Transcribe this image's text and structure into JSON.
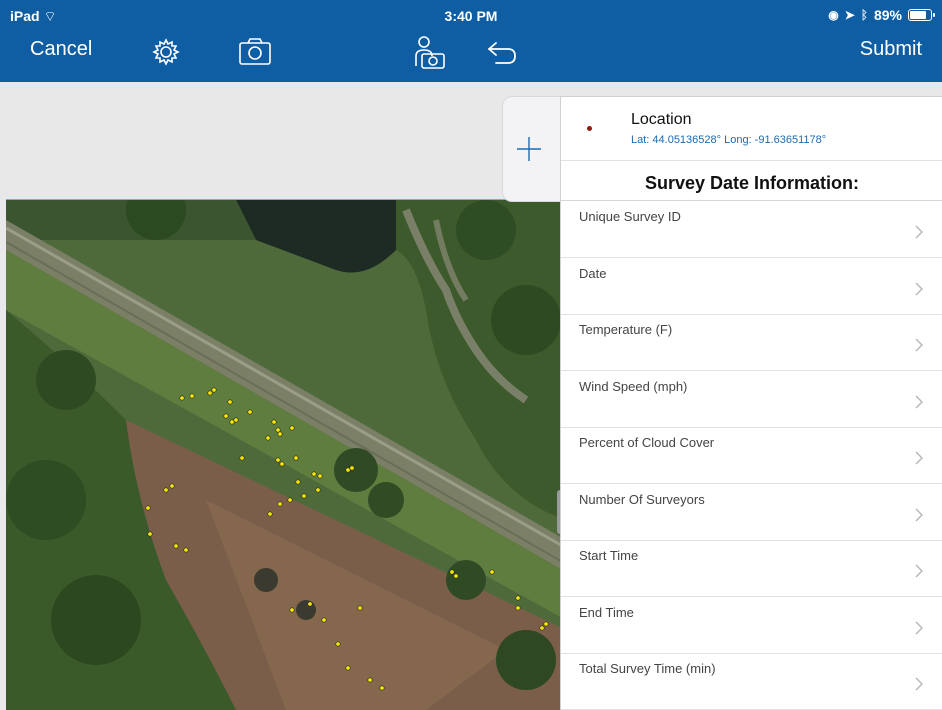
{
  "status_bar": {
    "carrier": "iPad",
    "time": "3:40 PM",
    "battery": "89%",
    "battery_level": 0.89
  },
  "toolbar": {
    "cancel_label": "Cancel",
    "submit_label": "Submit",
    "icons": [
      "gear-icon",
      "camera-icon",
      "collect-location-icon",
      "undo-icon"
    ]
  },
  "map": {
    "has_plus_button": true,
    "plus_icon": "plus-icon"
  },
  "panel": {
    "location": {
      "title": "Location",
      "coords": "Lat: 44.05136528° Long: -91.63651178°"
    },
    "section_title": "Survey Date Information:",
    "fields": [
      {
        "label": "Unique Survey ID"
      },
      {
        "label": "Date"
      },
      {
        "label": "Temperature (F)"
      },
      {
        "label": "Wind Speed (mph)"
      },
      {
        "label": "Percent of Cloud Cover"
      },
      {
        "label": "Number Of Surveyors"
      },
      {
        "label": "Start Time"
      },
      {
        "label": "End Time"
      },
      {
        "label": "Total Survey Time (min)"
      }
    ]
  },
  "colors": {
    "bar": "#0f5ea3",
    "link": "#1e6ab0",
    "accent_line": "#6eb1dc"
  }
}
